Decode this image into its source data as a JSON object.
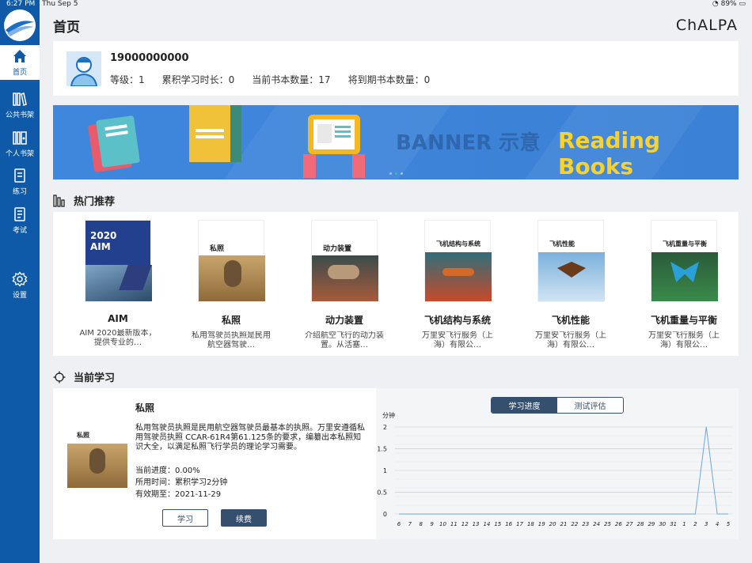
{
  "status_bar": {
    "time": "6:27 PM",
    "date": "Thu Sep 5",
    "battery": "89%"
  },
  "sidebar": {
    "items": [
      {
        "label": "首页",
        "icon": "home-icon"
      },
      {
        "label": "公共书架",
        "icon": "bookshelf-icon"
      },
      {
        "label": "个人书架",
        "icon": "personal-shelf-icon"
      },
      {
        "label": "练习",
        "icon": "practice-icon"
      },
      {
        "label": "考试",
        "icon": "exam-icon"
      },
      {
        "label": "设置",
        "icon": "gear-icon"
      }
    ]
  },
  "header": {
    "title": "首页",
    "brand": "ChALPA"
  },
  "profile": {
    "phone": "19000000000",
    "level_label": "等级：1",
    "study_time_label": "累积学习时长：0",
    "current_books_label": "当前书本数量：17",
    "expiring_books_label": "将到期书本数量：0"
  },
  "banner": {
    "mark": "BANNER 示意",
    "title": "Reading Books"
  },
  "recommend": {
    "heading": "热门推荐",
    "books": [
      {
        "title": "AIM",
        "desc": "AIM 2020最新版本，提供专业的…",
        "cover_title": "2020\nAIM"
      },
      {
        "title": "私照",
        "desc": "私用驾驶员执照是民用航空器驾驶…",
        "cover_title": "私照"
      },
      {
        "title": "动力装置",
        "desc": "介绍航空飞行的动力装置。从活塞…",
        "cover_title": "动力装置"
      },
      {
        "title": "飞机结构与系统",
        "desc": "万里安飞行服务（上海）有限公…",
        "cover_title": "飞机结构与系统"
      },
      {
        "title": "飞机性能",
        "desc": "万里安飞行服务（上海）有限公…",
        "cover_title": "飞机性能"
      },
      {
        "title": "飞机重量与平衡",
        "desc": "万里安飞行服务（上海）有限公…",
        "cover_title": "飞机重量与平衡"
      }
    ]
  },
  "current": {
    "heading": "当前学习",
    "title": "私照",
    "desc": "私用驾驶员执照是民用航空器驾驶员最基本的执照。万里安遵循私用驾驶员执照 CCAR-61R4第61.125条的要求，编纂出本私照知识大全，以满足私照飞行学员的理论学习需要。",
    "progress": "当前进度：0.00%",
    "time_used": "所用时间：累积学习2分钟",
    "expiry": "有效期至：2021-11-29",
    "btn_study": "学习",
    "btn_renew": "续费",
    "cover_title": "私照"
  },
  "chart_tabs": {
    "active": "学习进度",
    "inactive": "测试评估"
  },
  "chart_data": {
    "type": "line",
    "ylabel": "分钟",
    "ylim": [
      0,
      2
    ],
    "yticks": [
      "0",
      "0.5",
      "1",
      "1.5",
      "2"
    ],
    "x": [
      "6",
      "7",
      "8",
      "9",
      "10",
      "11",
      "12",
      "13",
      "14",
      "15",
      "16",
      "17",
      "18",
      "19",
      "20",
      "21",
      "22",
      "23",
      "24",
      "25",
      "26",
      "27",
      "28",
      "29",
      "30",
      "31",
      "1",
      "2",
      "3",
      "4",
      "5"
    ],
    "values": [
      0,
      0,
      0,
      0,
      0,
      0,
      0,
      0,
      0,
      0,
      0,
      0,
      0,
      0,
      0,
      0,
      0,
      0,
      0,
      0,
      0,
      0,
      0,
      0,
      0,
      0,
      0,
      0,
      2,
      0,
      0
    ],
    "color": "#6aa8e0"
  }
}
